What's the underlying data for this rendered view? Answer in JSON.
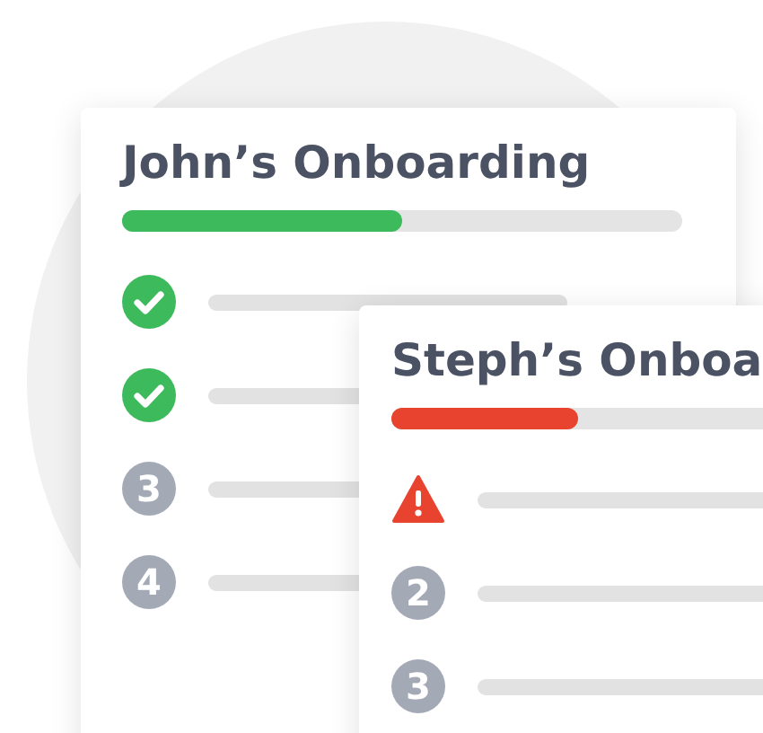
{
  "cards": [
    {
      "title": "John’s Onboarding",
      "progress": {
        "level": 0.5,
        "color": "#3dba5c"
      },
      "items": [
        {
          "kind": "done"
        },
        {
          "kind": "done"
        },
        {
          "kind": "number",
          "number": "3"
        },
        {
          "kind": "number",
          "number": "4"
        }
      ]
    },
    {
      "title": "Steph’s Onboa",
      "progress": {
        "level": 0.4,
        "color": "#e8432e"
      },
      "items": [
        {
          "kind": "warning"
        },
        {
          "kind": "number",
          "number": "2"
        },
        {
          "kind": "number",
          "number": "3"
        }
      ]
    }
  ]
}
